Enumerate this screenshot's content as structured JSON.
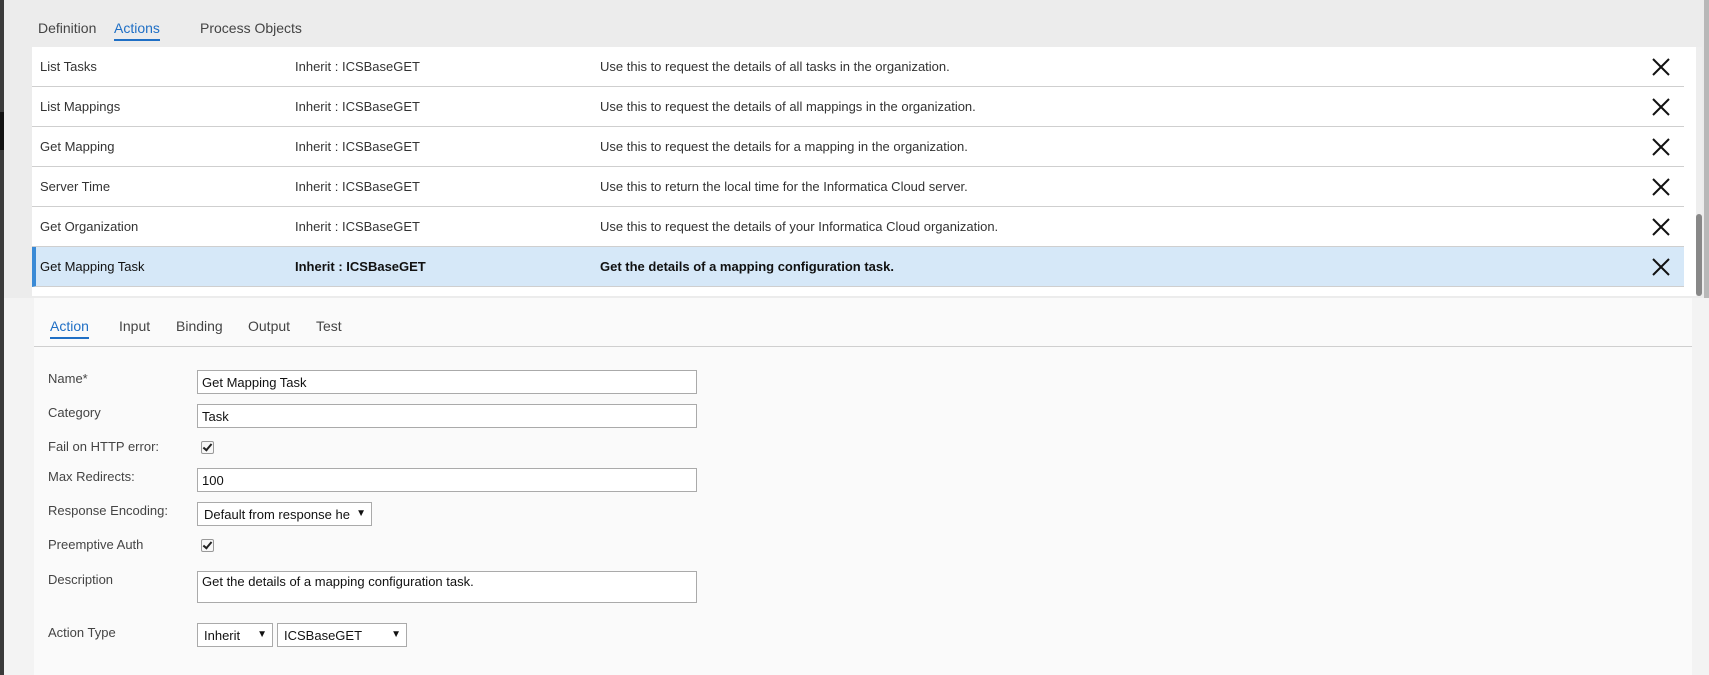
{
  "top_tabs": [
    {
      "label": "Definition"
    },
    {
      "label": "Actions"
    },
    {
      "label": "Process Objects"
    }
  ],
  "actions_table": {
    "rows": [
      {
        "name": "List Tasks",
        "type": "Inherit : ICSBaseGET",
        "description": "Use this to request the details of all tasks in the organization."
      },
      {
        "name": "List Mappings",
        "type": "Inherit : ICSBaseGET",
        "description": "Use this to request the details of all mappings in the organization."
      },
      {
        "name": "Get Mapping",
        "type": "Inherit : ICSBaseGET",
        "description": "Use this to request the details for a mapping in the organization."
      },
      {
        "name": "Server Time",
        "type": "Inherit : ICSBaseGET",
        "description": "Use this to return the local time for the Informatica Cloud server."
      },
      {
        "name": "Get Organization",
        "type": "Inherit : ICSBaseGET",
        "description": "Use this to request the details of your Informatica Cloud organization."
      },
      {
        "name": "Get Mapping Task",
        "type": "Inherit : ICSBaseGET",
        "description": "Get the details of a mapping configuration task."
      }
    ],
    "delete_icon": "close-icon"
  },
  "inner_tabs": [
    {
      "label": "Action"
    },
    {
      "label": "Input"
    },
    {
      "label": "Binding"
    },
    {
      "label": "Output"
    },
    {
      "label": "Test"
    }
  ],
  "form": {
    "name_label": "Name*",
    "name_value": "Get Mapping Task",
    "category_label": "Category",
    "category_value": "Task",
    "fail_http_label": "Fail on HTTP error:",
    "fail_http_checked": true,
    "max_redirects_label": "Max Redirects:",
    "max_redirects_value": "100",
    "response_encoding_label": "Response Encoding:",
    "response_encoding_value": "Default from response he",
    "preemptive_auth_label": "Preemptive Auth",
    "preemptive_auth_checked": true,
    "description_label": "Description",
    "description_value": "Get the details of a mapping configuration task.",
    "action_type_label": "Action Type",
    "action_type_mode": "Inherit",
    "action_type_base": "ICSBaseGET"
  },
  "colors": {
    "accent": "#1f6fc5",
    "selected_row": "#d6e8f8",
    "selected_bar": "#3a8ad6"
  }
}
